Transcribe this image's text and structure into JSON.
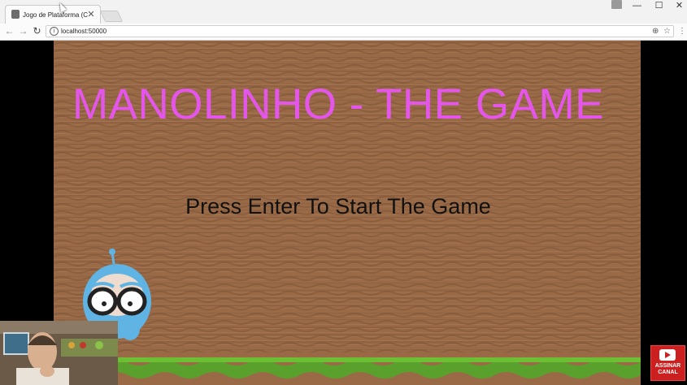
{
  "browser": {
    "tab": {
      "title": "Jogo de Plataforma (Con",
      "close_glyph": "✕"
    },
    "window_controls": {
      "minimize": "—",
      "maximize": "☐",
      "close": "✕"
    },
    "toolbar": {
      "back": "←",
      "forward": "→",
      "reload": "↻",
      "url": "localhost:50000",
      "zoom": "⊕",
      "star": "☆",
      "menu": "⋮"
    }
  },
  "game": {
    "title": "MANOLINHO - THE GAME",
    "prompt": "Press Enter To Start The Game",
    "colors": {
      "title": "#e455ea",
      "background": "#9a6a47",
      "ground": "#5aa02c"
    }
  },
  "subscribe": {
    "line1": "ASSINAR",
    "line2": "CANAL"
  }
}
